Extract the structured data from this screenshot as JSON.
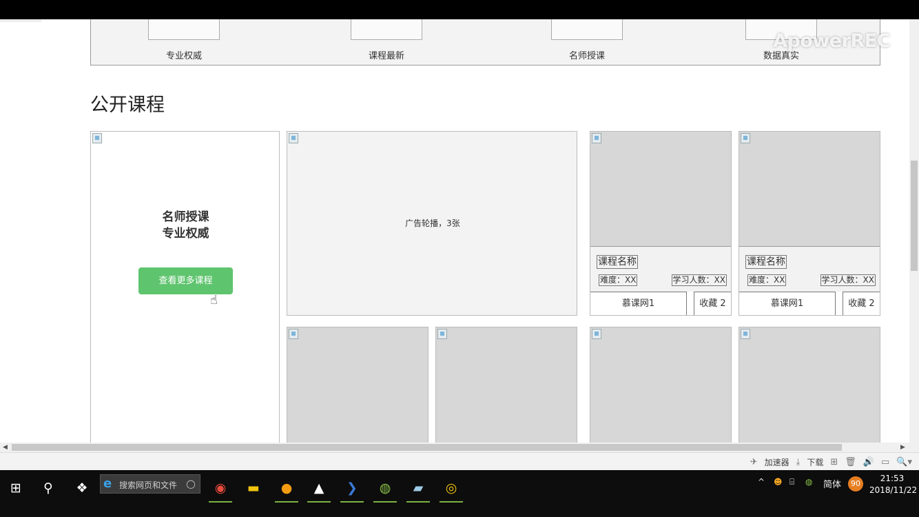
{
  "watermark": "ApowerREC",
  "features": [
    "专业权威",
    "课程最新",
    "名师授课",
    "数据真实"
  ],
  "section_title": "公开课程",
  "promo": {
    "line1": "名师授课",
    "line2": "专业权威",
    "button": "查看更多课程"
  },
  "carousel_text": "广告轮播，3张",
  "course_cards": [
    {
      "name": "课程名称",
      "difficulty": "难度：XX",
      "learners": "学习人数：XX",
      "provider": "慕课网1",
      "favorite": "收藏  2"
    },
    {
      "name": "课程名称",
      "difficulty": "难度：XX",
      "learners": "学习人数：XX",
      "provider": "慕课网1",
      "favorite": "收藏  2"
    }
  ],
  "statusbar": {
    "accelerator": "加速器",
    "download": "下载"
  },
  "taskbar": {
    "search_placeholder": "搜索网页和文件",
    "ime": "简体",
    "badge": "90",
    "time": "21:53",
    "date": "2018/11/22"
  }
}
